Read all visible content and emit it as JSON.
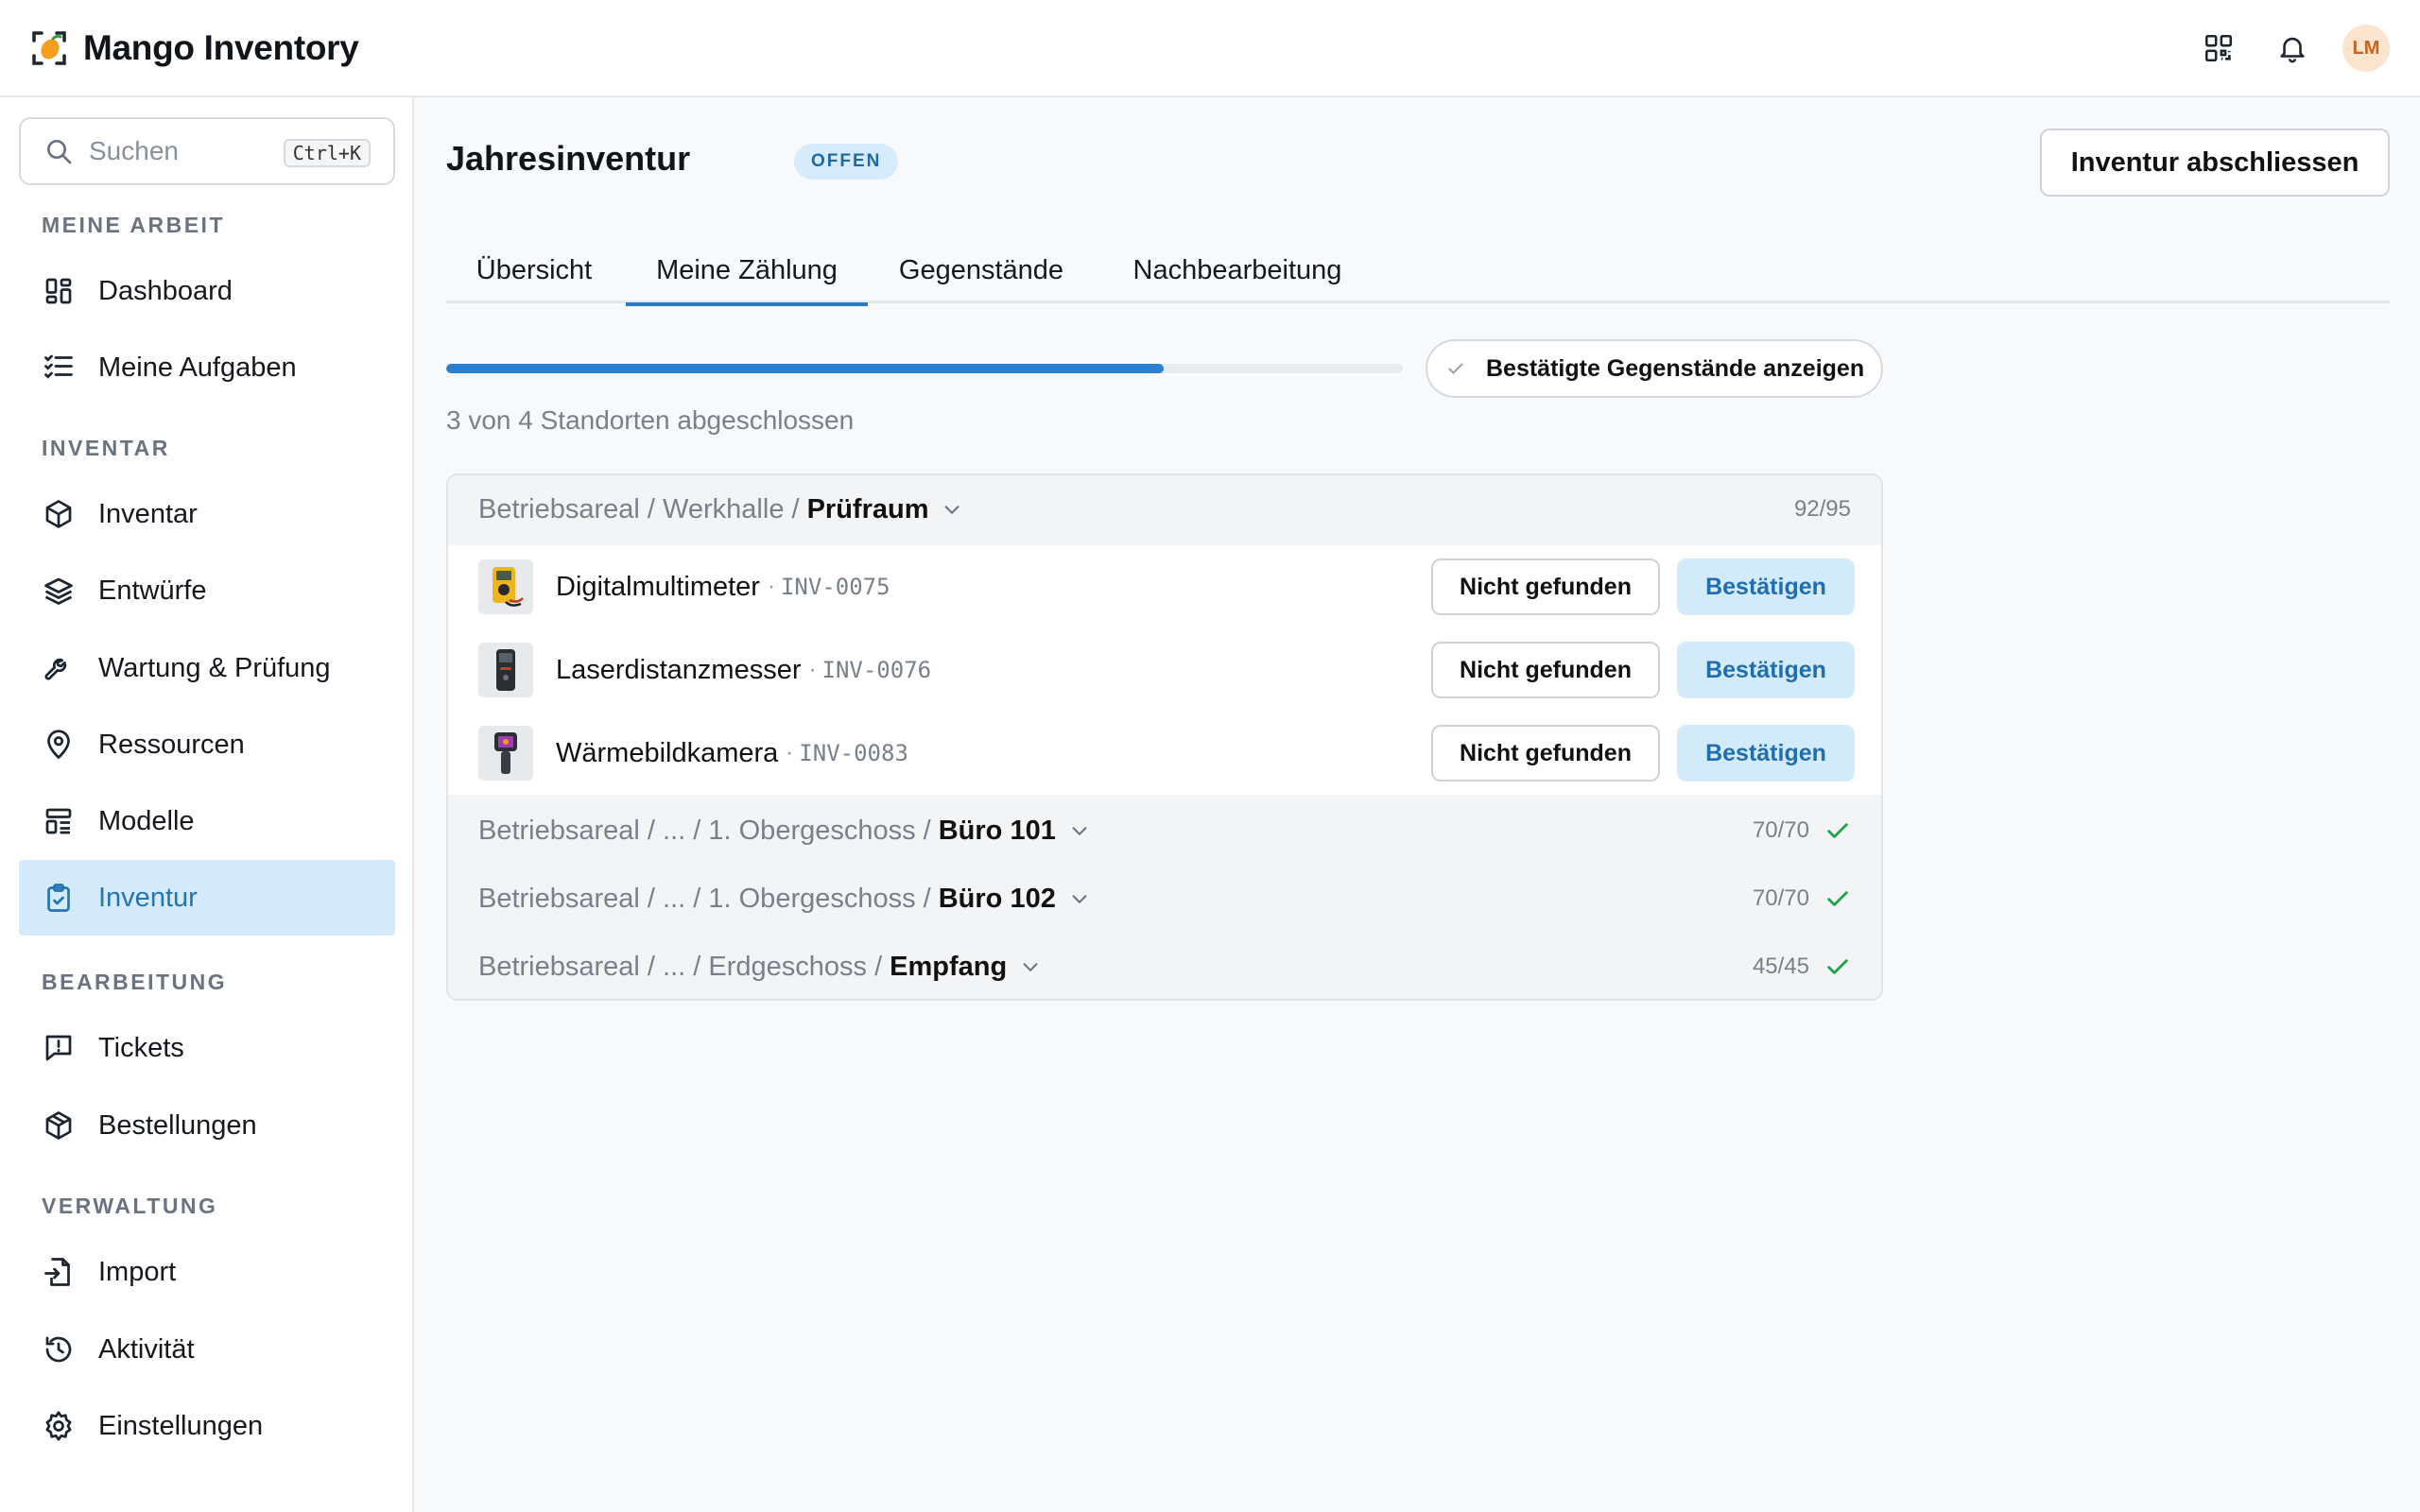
{
  "app": {
    "name": "Mango Inventory",
    "user_initials": "LM"
  },
  "header": {
    "qr_icon": "qr-code-icon",
    "bell_icon": "bell-icon"
  },
  "search": {
    "placeholder": "Suchen",
    "shortcut": "Ctrl+K"
  },
  "sidebar": {
    "sections": [
      {
        "label": "MEINE ARBEIT",
        "items": [
          {
            "label": "Dashboard",
            "icon": "dashboard-icon"
          },
          {
            "label": "Meine Aufgaben",
            "icon": "task-list-icon"
          }
        ]
      },
      {
        "label": "INVENTAR",
        "items": [
          {
            "label": "Inventar",
            "icon": "box-icon"
          },
          {
            "label": "Entwürfe",
            "icon": "layers-icon"
          },
          {
            "label": "Wartung & Prüfung",
            "icon": "wrench-icon"
          },
          {
            "label": "Ressourcen",
            "icon": "location-pin-icon"
          },
          {
            "label": "Modelle",
            "icon": "template-icon"
          },
          {
            "label": "Inventur",
            "icon": "clipboard-check-icon",
            "active": true
          }
        ]
      },
      {
        "label": "BEARBEITUNG",
        "items": [
          {
            "label": "Tickets",
            "icon": "message-alert-icon"
          },
          {
            "label": "Bestellungen",
            "icon": "package-icon"
          }
        ]
      },
      {
        "label": "VERWALTUNG",
        "items": [
          {
            "label": "Import",
            "icon": "file-import-icon"
          },
          {
            "label": "Aktivität",
            "icon": "history-icon"
          },
          {
            "label": "Einstellungen",
            "icon": "gear-icon"
          }
        ]
      }
    ]
  },
  "page": {
    "title": "Jahresinventur",
    "status": "OFFEN",
    "close_button": "Inventur abschliessen",
    "tabs": [
      {
        "label": "Übersicht"
      },
      {
        "label": "Meine Zählung",
        "active": true
      },
      {
        "label": "Gegenstände"
      },
      {
        "label": "Nachbearbeitung"
      }
    ],
    "progress": {
      "completed": 3,
      "total": 4,
      "fraction": 0.75,
      "label": "3 von 4 Standorten abgeschlossen"
    },
    "show_confirmed_label": "Bestätigte Gegenstände anzeigen"
  },
  "locations": [
    {
      "path": "Betriebsareal / Werkhalle /",
      "name": "Prüfraum",
      "count": "92/95",
      "complete": false,
      "expanded": true,
      "items": [
        {
          "name": "Digitalmultimeter",
          "code": "INV-0075",
          "thumb": "multimeter-image"
        },
        {
          "name": "Laserdistanzmesser",
          "code": "INV-0076",
          "thumb": "laser-meter-image"
        },
        {
          "name": "Wärmebildkamera",
          "code": "INV-0083",
          "thumb": "thermal-camera-image"
        }
      ]
    },
    {
      "path": "Betriebsareal / ... / 1. Obergeschoss /",
      "name": "Büro 101",
      "count": "70/70",
      "complete": true
    },
    {
      "path": "Betriebsareal / ... / 1. Obergeschoss /",
      "name": "Büro 102",
      "count": "70/70",
      "complete": true
    },
    {
      "path": "Betriebsareal / ... / Erdgeschoss /",
      "name": "Empfang",
      "count": "45/45",
      "complete": true
    }
  ],
  "actions": {
    "not_found": "Nicht gefunden",
    "confirm": "Bestätigen"
  },
  "colors": {
    "accent": "#2b7fd3",
    "active_bg": "#d5ebfb",
    "success": "#22a34a",
    "badge_bg": "#d6ebfb"
  }
}
